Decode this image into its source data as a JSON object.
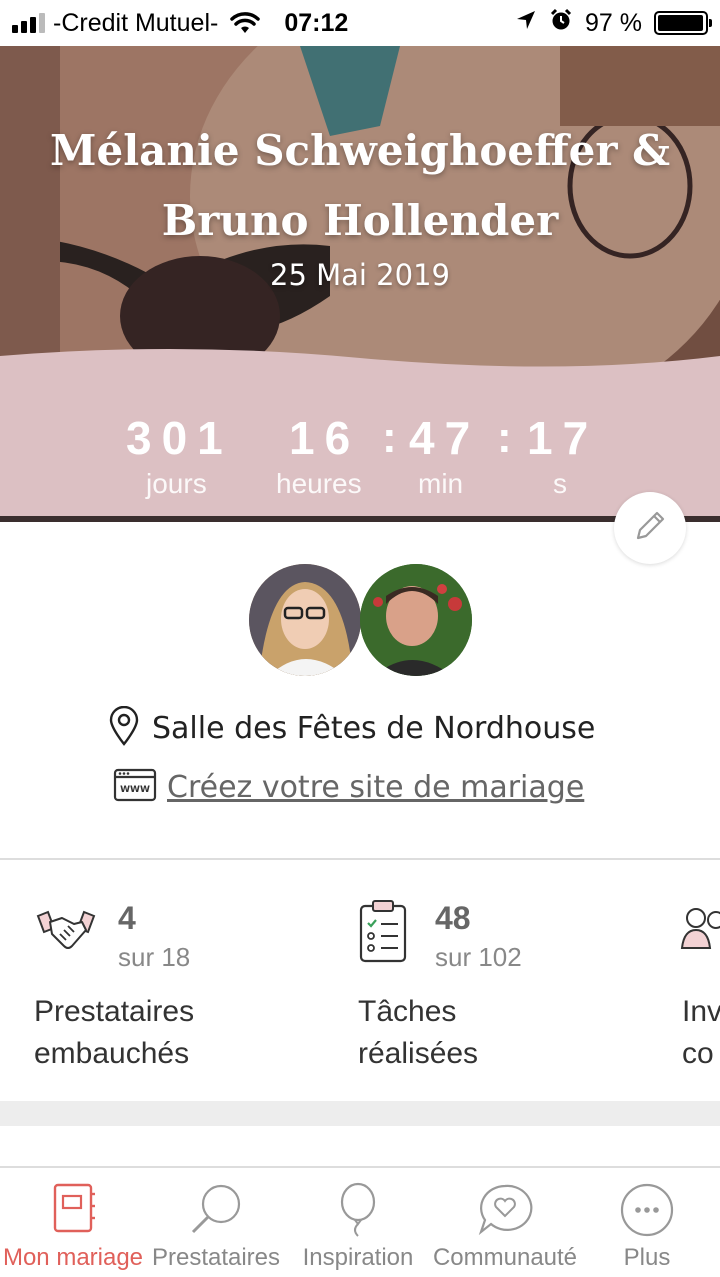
{
  "status_bar": {
    "carrier": "-Credit Mutuel-",
    "time": "07:12",
    "battery_percent": "97 %",
    "battery_level": 0.97
  },
  "hero": {
    "names_line1": "Mélanie Schweighoeffer &",
    "names_line2": "Bruno Hollender",
    "date": "25 Mai 2019",
    "accent_color": "#dcc0c3"
  },
  "countdown": {
    "days": "301",
    "hours": "16",
    "minutes": "47",
    "seconds": "17",
    "separator": ":",
    "days_label": "jours",
    "hours_label": "heures",
    "minutes_label": "min",
    "seconds_label": "s"
  },
  "profile": {
    "location": "Salle des Fêtes de Nordhouse",
    "site_link": "Créez votre site de mariage"
  },
  "stats": [
    {
      "icon": "handshake-icon",
      "value": "4",
      "total": "sur 18",
      "label_line1": "Prestataires",
      "label_line2": "embauchés"
    },
    {
      "icon": "checklist-icon",
      "value": "48",
      "total": "sur 102",
      "label_line1": "Tâches",
      "label_line2": "réalisées"
    },
    {
      "icon": "guests-icon",
      "label_line1": "Inv",
      "label_line2": "co"
    }
  ],
  "tabs": [
    {
      "label": "Mon mariage",
      "icon": "notebook-icon",
      "active": true
    },
    {
      "label": "Prestataires",
      "icon": "search-icon"
    },
    {
      "label": "Inspiration",
      "icon": "balloon-icon"
    },
    {
      "label": "Communauté",
      "icon": "chat-heart-icon"
    },
    {
      "label": "Plus",
      "icon": "more-icon"
    }
  ],
  "colors": {
    "brand": "#e0605a",
    "countdown_band": "#dcc0c3",
    "muted_text": "#888888"
  }
}
